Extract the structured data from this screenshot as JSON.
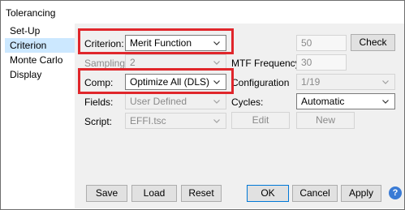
{
  "window": {
    "title": "Tolerancing"
  },
  "nav": {
    "items": [
      {
        "label": "Set-Up",
        "selected": false
      },
      {
        "label": "Criterion",
        "selected": true
      },
      {
        "label": "Monte Carlo",
        "selected": false
      },
      {
        "label": "Display",
        "selected": false
      }
    ]
  },
  "form": {
    "criterion": {
      "label": "Criterion:",
      "value": "Merit Function"
    },
    "sampling": {
      "label": "Sampling:",
      "value": "2"
    },
    "comp": {
      "label": "Comp:",
      "value": "Optimize All (DLS)"
    },
    "fields": {
      "label": "Fields:",
      "value": "User Defined"
    },
    "script": {
      "label": "Script:",
      "value": "EFFI.tsc"
    },
    "cycles_input": {
      "value": "50"
    },
    "check_button": {
      "label": "Check"
    },
    "mtf_frequency": {
      "label": "MTF Frequency:",
      "value": "30"
    },
    "configuration": {
      "label": "Configuration",
      "value": "1/19"
    },
    "cycles": {
      "label": "Cycles:",
      "value": "Automatic"
    },
    "edit_button": {
      "label": "Edit"
    },
    "new_button": {
      "label": "New"
    }
  },
  "footer": {
    "save": "Save",
    "load": "Load",
    "reset": "Reset",
    "ok": "OK",
    "cancel": "Cancel",
    "apply": "Apply",
    "help_icon": "?"
  },
  "colors": {
    "highlight": "#e0262b",
    "nav_selected": "#cce8ff",
    "panel_bg": "#f0f0f0"
  }
}
